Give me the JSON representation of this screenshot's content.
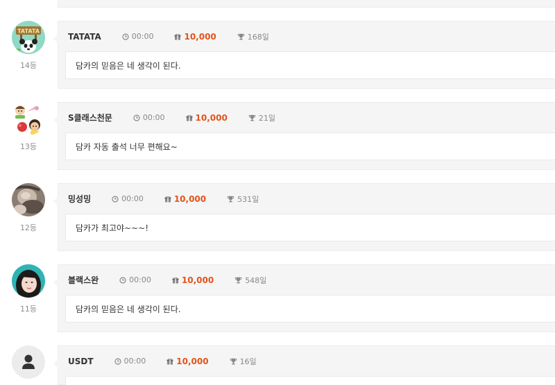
{
  "entries": [
    {
      "rank": "14등",
      "nickname": "TATATA",
      "time": "00:00",
      "points": "10,000",
      "streak": "168일",
      "message": "담카의 믿음은 네 생각이 된다.",
      "avatar": "tatata-sign-avatar"
    },
    {
      "rank": "13등",
      "nickname": "S클래스천문",
      "time": "00:00",
      "points": "10,000",
      "streak": "21일",
      "message": "담카 자동 출석 너무 편해요~",
      "avatar": "cartoon-characters-avatar"
    },
    {
      "rank": "12등",
      "nickname": "밍성밍",
      "time": "00:00",
      "points": "10,000",
      "streak": "531일",
      "message": "담카가 최고야~~~!",
      "avatar": "photo-avatar"
    },
    {
      "rank": "11등",
      "nickname": "블랙스완",
      "time": "00:00",
      "points": "10,000",
      "streak": "548일",
      "message": "담카의 믿음은 네 생각이 된다.",
      "avatar": "portrait-photo-avatar"
    },
    {
      "rank": "",
      "nickname": "USDT",
      "time": "00:00",
      "points": "10,000",
      "streak": "16일",
      "message": "",
      "avatar": "default-user-avatar"
    }
  ],
  "colors": {
    "points": "#e2541c",
    "card_bg": "#f5f5f5",
    "rank_text": "#8c8c8c"
  }
}
